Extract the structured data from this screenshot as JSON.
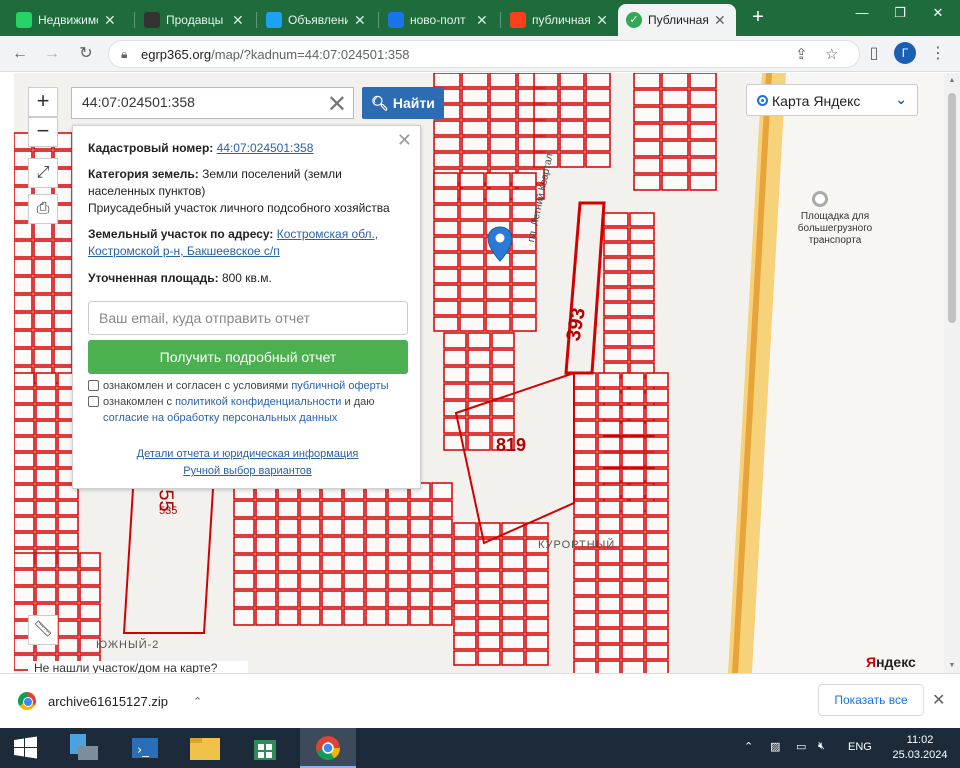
{
  "browser": {
    "tabs": [
      {
        "title": "Недвижимость",
        "favicon_color": "#25d366"
      },
      {
        "title": "Продавцы",
        "favicon_color": "#333333"
      },
      {
        "title": "Объявления",
        "favicon_color": "#1da1f2"
      },
      {
        "title": "ново-полт",
        "favicon_color": "#1a73e8"
      },
      {
        "title": "публичная",
        "favicon_color": "#fc3f1d"
      },
      {
        "title": "Публичная",
        "favicon_color": "#34a853"
      }
    ],
    "new_tab": "+",
    "url_host": "egrp365.org",
    "url_path": "/map/?kadnum=44:07:024501:358",
    "profile_initial": "Г",
    "accent": "#1e6b3c"
  },
  "map": {
    "search_value": "44:07:024501:358",
    "find_label": "Найти",
    "layer_label": "Карта Яндекс",
    "zoom_in": "+",
    "zoom_out": "−",
    "logo": {
      "red": "Я",
      "rest": "ндекс"
    },
    "bottom_tooltip": "Не нашли участок/дом на карте?",
    "labels": {
      "poi": "Площадка для большегрузного транспорта",
      "district1": "КУРОРТНЫЙ",
      "district2": "ЮЖНЫЙ-2",
      "street": "пл. Летний Квартал",
      "big_parcel": "819",
      "parcel_393": "393",
      "parcel_55": "55",
      "parcel_535": "535"
    }
  },
  "panel": {
    "cadastral_label": "Кадастровый номер:",
    "cadastral_value": "44:07:024501:358",
    "category_label": "Категория земель:",
    "category_value": "Земли поселений (земли населенных пунктов)",
    "use_value": "Приусадебный участок личного подсобного хозяйства",
    "address_label": "Земельный участок по адресу:",
    "address_line1": "Костромская обл.,",
    "address_line2": "Костромской р-н, Бакшеевское с/п",
    "area_label": "Уточненная площадь:",
    "area_value": "800 кв.м.",
    "email_placeholder": "Ваш email, куда отправить отчет",
    "get_report": "Получить подробный отчет",
    "agree1_a": "ознакомлен и согласен с условиями ",
    "agree1_link": "публичной оферты",
    "agree2_a": "ознакомлен с ",
    "agree2_link": "политикой конфиденциальности",
    "agree2_b": " и даю",
    "agree2_link2": "согласие на обработку персональных данных",
    "details_link": "Детали отчета и юридическая информация",
    "manual_link": "Ручной выбор вариантов"
  },
  "downloads": {
    "file_name": "archive61615127.zip",
    "show_all": "Показать все"
  },
  "taskbar": {
    "lang": "ENG",
    "time": "11:02",
    "date": "25.03.2024"
  }
}
